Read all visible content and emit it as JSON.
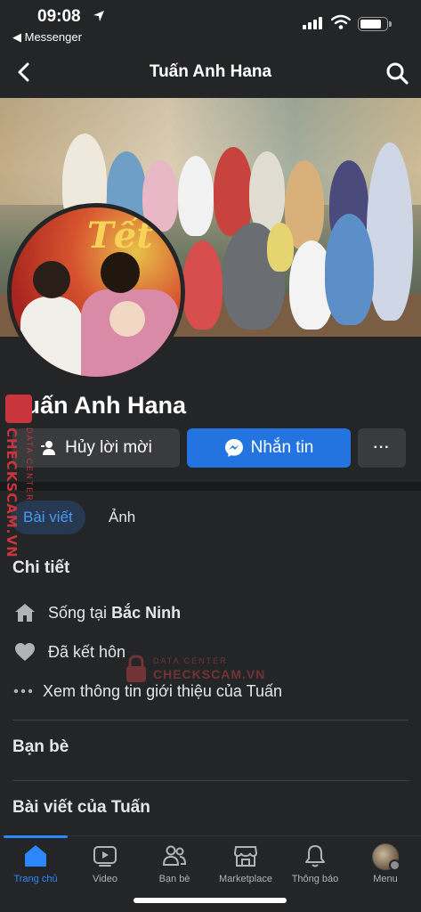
{
  "status_bar": {
    "time": "09:08",
    "back_app": "◀ Messenger",
    "battery_level": 0.85
  },
  "navbar": {
    "title": "Tuấn Anh Hana"
  },
  "profile": {
    "avatar_text": "Tết",
    "name": "Tuấn Anh Hana",
    "cancel_request_label": "Hủy lời mời",
    "message_label": "Nhắn tin",
    "more_label": "···"
  },
  "tabs": [
    {
      "label": "Bài viết"
    },
    {
      "label": "Ảnh"
    }
  ],
  "details": {
    "title": "Chi tiết",
    "lives_prefix": "Sống tại ",
    "lives_place": "Bắc Ninh",
    "relationship": "Đã kết hôn",
    "see_more": "Xem thông tin giới thiệu của Tuấn"
  },
  "friends": {
    "title": "Bạn bè"
  },
  "posts": {
    "title": "Bài viết của Tuấn"
  },
  "bottom_tabs": [
    {
      "label": "Trang chủ",
      "icon": "home-icon"
    },
    {
      "label": "Video",
      "icon": "video-icon"
    },
    {
      "label": "Bạn bè",
      "icon": "friends-icon"
    },
    {
      "label": "Marketplace",
      "icon": "marketplace-icon"
    },
    {
      "label": "Thông báo",
      "icon": "bell-icon"
    },
    {
      "label": "Menu",
      "icon": "menu-avatar"
    }
  ],
  "watermark": {
    "side_main": "CHECKSCAM.VN",
    "side_sub": "DATA CENTER",
    "center_sub": "DATA CENTER",
    "center_main": "CHECKSCAM.VN"
  },
  "colors": {
    "background": "#242526",
    "accent": "#2374e1",
    "active_tab_text": "#4a9af5",
    "watermark": "#c9353c"
  }
}
